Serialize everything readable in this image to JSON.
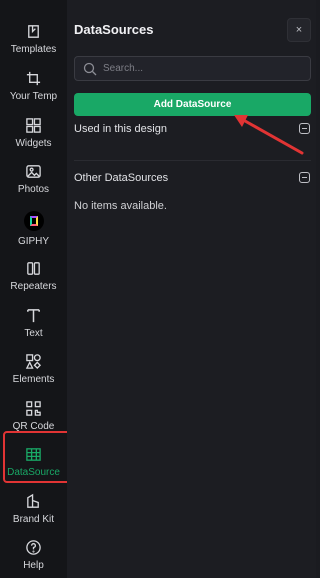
{
  "rail": {
    "items": [
      {
        "label": "Templates",
        "icon": "templates-icon"
      },
      {
        "label": "Your Temp",
        "icon": "crop-icon"
      },
      {
        "label": "Widgets",
        "icon": "widgets-icon"
      },
      {
        "label": "Photos",
        "icon": "photo-icon"
      },
      {
        "label": "GIPHY",
        "icon": "giphy-icon"
      },
      {
        "label": "Repeaters",
        "icon": "columns-icon"
      },
      {
        "label": "Text",
        "icon": "text-icon"
      },
      {
        "label": "Elements",
        "icon": "shapes-icon"
      },
      {
        "label": "QR Code",
        "icon": "qr-icon"
      },
      {
        "label": "DataSource",
        "icon": "table-icon"
      },
      {
        "label": "Brand Kit",
        "icon": "brand-kit-icon"
      },
      {
        "label": "Help",
        "icon": "help-icon"
      }
    ],
    "active": "DataSource"
  },
  "panel": {
    "title": "DataSources",
    "close_label": "×",
    "search_placeholder": "Search...",
    "add_button": "Add DataSource",
    "sections": [
      {
        "title": "Used in this design"
      },
      {
        "title": "Other DataSources",
        "empty_text": "No items available."
      }
    ]
  },
  "colors": {
    "accent": "#19a866",
    "highlight": "#e13434",
    "background": "#1c1d22"
  }
}
